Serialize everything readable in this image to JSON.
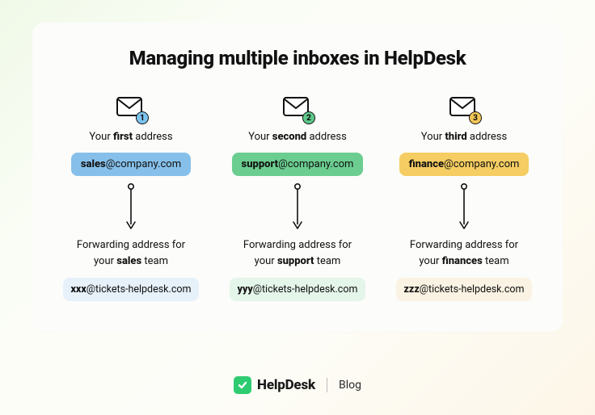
{
  "title": "Managing multiple inboxes in HelpDesk",
  "columns": [
    {
      "ordinal": "first",
      "badge_number": "1",
      "badge_color": "#7dc4f0",
      "chip_bold": "sales",
      "chip_rest": "@company.com",
      "chip_bg": "#86c0ea",
      "fwd_team": "sales",
      "fwd_bold": "xxx",
      "fwd_rest": "@tickets-helpdesk.com",
      "fwd_bg": "#e6f1fa"
    },
    {
      "ordinal": "second",
      "badge_number": "2",
      "badge_color": "#5fc98b",
      "chip_bold": "support",
      "chip_rest": "@company.com",
      "chip_bg": "#6bce90",
      "fwd_team": "support",
      "fwd_bold": "yyy",
      "fwd_rest": "@tickets-helpdesk.com",
      "fwd_bg": "#e4f5ea"
    },
    {
      "ordinal": "third",
      "badge_number": "3",
      "badge_color": "#f3c657",
      "chip_bold": "finance",
      "chip_rest": "@company.com",
      "chip_bg": "#f5cd62",
      "fwd_team": "finances",
      "fwd_bold": "zzz",
      "fwd_rest": "@tickets-helpdesk.com",
      "fwd_bg": "#faf2e2"
    }
  ],
  "labels": {
    "your": "Your ",
    "address": " address",
    "fwd_prefix": "Forwarding address for",
    "fwd_your": "your ",
    "fwd_suffix": " team"
  },
  "footer": {
    "brand": "HelpDesk",
    "section": "Blog"
  }
}
